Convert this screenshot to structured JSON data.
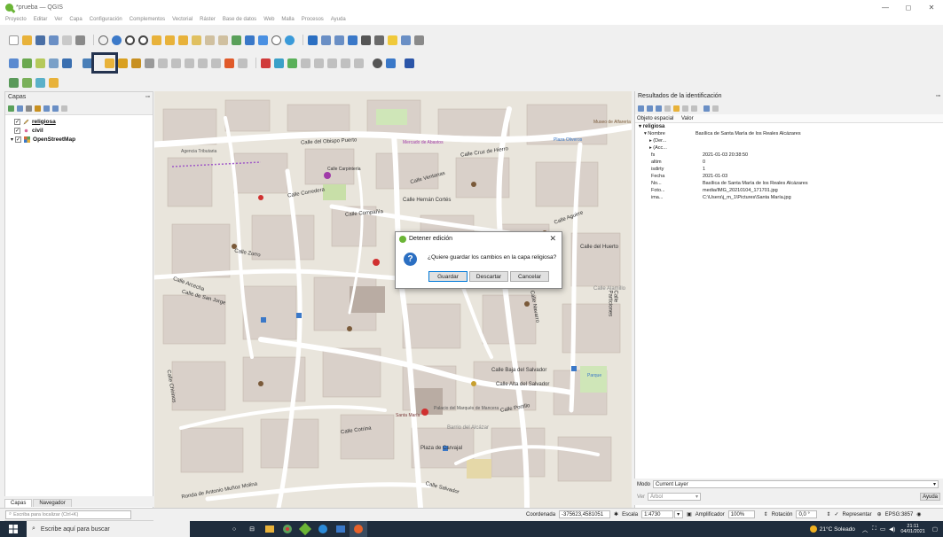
{
  "window": {
    "title": "*prueba — QGIS",
    "controls": [
      "—",
      "◻",
      "✕"
    ]
  },
  "menu": [
    "Proyecto",
    "Editar",
    "Ver",
    "Capa",
    "Configuración",
    "Complementos",
    "Vectorial",
    "Ráster",
    "Base de datos",
    "Web",
    "Malla",
    "Procesos",
    "Ayuda"
  ],
  "layers_panel": {
    "title": "Capas",
    "layers": [
      {
        "name": "religiosa",
        "checked": "✓"
      },
      {
        "name": "civil",
        "checked": "✓"
      },
      {
        "name": "OpenStreetMap",
        "checked": "✓"
      }
    ]
  },
  "left_tabs": {
    "layers": "Capas",
    "navigator": "Navegador"
  },
  "identify_panel": {
    "title": "Resultados de la identificación",
    "header_feature": "Objeto espacial",
    "header_value": "Valor",
    "layer": "religiosa",
    "rows": [
      {
        "k": "▾ Nombre",
        "v": "Basílica de Santa María de los Reales Alcázares"
      },
      {
        "k": "▸ (Der...",
        "v": ""
      },
      {
        "k": "▸ (Acc...",
        "v": ""
      },
      {
        "k": "fs",
        "v": "2021-01-03 20:38:50"
      },
      {
        "k": "altim",
        "v": "0"
      },
      {
        "k": "isdirty",
        "v": "1"
      },
      {
        "k": "Fecha",
        "v": "2021-01-03"
      },
      {
        "k": "No...",
        "v": "Basílica de Santa María de los Reales Alcázares"
      },
      {
        "k": "Foto...",
        "v": "media/IMG_20210104_171701.jpg"
      },
      {
        "k": "ima...",
        "v": "C:\\Users\\j_m_1\\Pictures\\Santa María.jpg"
      }
    ],
    "mode_label": "Modo",
    "mode_value": "Current Layer",
    "view_label": "Ver",
    "view_value": "Árbol",
    "help": "Ayuda"
  },
  "dialog": {
    "title": "Detener edición",
    "message": "¿Quiere guardar los cambios en la capa religiosa?",
    "buttons": {
      "save": "Guardar",
      "discard": "Descartar",
      "cancel": "Cancelar"
    }
  },
  "map_labels": [
    "Calle del Obispo Puerto",
    "Calle Cruz de Hierro",
    "Calle Compañía",
    "Calle Arcecha",
    "Calle Zorro",
    "Calle Corredera",
    "Calle Ventanas",
    "Calle Hernán Cortés",
    "Calle de San Jorge",
    "Calle Baja del Salvador",
    "Calle Alta del Salvador",
    "Calle Portillo",
    "Calle Cotrina",
    "Calle Salvador",
    "Ronda de Antonio Muñoz Molina",
    "Calle del Huerto",
    "Calle Particiones",
    "Calle Navarro",
    "Calle Carpintería",
    "Plaza de Carvajal",
    "Barrio del Alcázar",
    "Santa María",
    "Palacio del Marqués de Mancera",
    "Calle Aguirre",
    "Calle Chirinos",
    "Calle Alamillo",
    "Museo de Alfarería",
    "Mercado de Abastos",
    "Plaza Oliveros",
    "Agencia Tributaria",
    "Parque"
  ],
  "status": {
    "locator_placeholder": "Escriba para localizar (Ctrl+K)",
    "coord_label": "Coordenada",
    "coord_value": "-375623,4581051",
    "scale_label": "Escala",
    "scale_value": "1:4730",
    "magnifier_label": "Amplificador",
    "magnifier_value": "100%",
    "rotation_label": "Rotación",
    "rotation_value": "0,0 °",
    "render_label": "Representar",
    "crs": "EPSG:3857"
  },
  "taskbar": {
    "search_placeholder": "Escribe aquí para buscar",
    "weather": "21°C  Soleado",
    "time": "21:11",
    "date": "04/01/2021"
  },
  "colors": {
    "accent": "#2b6fc2",
    "highlight_box": "#24334f",
    "map_bg": "#e9e5dc",
    "taskbar": "#1f2d3d"
  }
}
